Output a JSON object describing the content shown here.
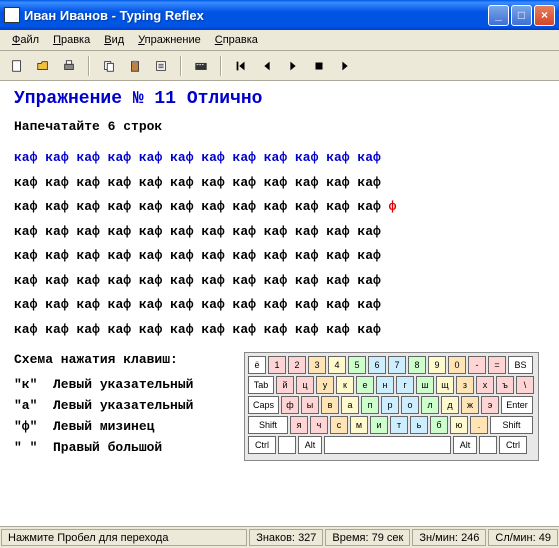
{
  "window": {
    "title": "Иван Иванов - Typing Reflex"
  },
  "menu": {
    "items": [
      "Файл",
      "Правка",
      "Вид",
      "Упражнение",
      "Справка"
    ]
  },
  "exercise": {
    "title": "Упражнение № 11  Отлично",
    "instruction": "Напечатайте 6 строк",
    "word": "каф",
    "error_char": "ф"
  },
  "scheme": {
    "title": "Схема нажатия клавиш:",
    "rows": [
      {
        "key": "\"к\"",
        "desc": "Левый указательный"
      },
      {
        "key": "\"а\"",
        "desc": "Левый указательный"
      },
      {
        "key": "\"ф\"",
        "desc": "Левый мизинец"
      },
      {
        "key": "\" \"",
        "desc": "Правый большой"
      }
    ]
  },
  "keyboard": {
    "row1": [
      "ё",
      "1",
      "2",
      "3",
      "4",
      "5",
      "6",
      "7",
      "8",
      "9",
      "0",
      "-",
      "=",
      "BS"
    ],
    "row2": [
      "Tab",
      "й",
      "ц",
      "у",
      "к",
      "е",
      "н",
      "г",
      "ш",
      "щ",
      "з",
      "х",
      "ъ",
      "\\"
    ],
    "row3": [
      "Caps",
      "ф",
      "ы",
      "в",
      "а",
      "п",
      "р",
      "о",
      "л",
      "д",
      "ж",
      "э",
      "Enter"
    ],
    "row4": [
      "Shift",
      "я",
      "ч",
      "с",
      "м",
      "и",
      "т",
      "ь",
      "б",
      "ю",
      ".",
      "Shift"
    ],
    "row5": [
      "Ctrl",
      "",
      "Alt",
      "",
      "Alt",
      "",
      "Ctrl"
    ]
  },
  "status": {
    "hint": "Нажмите Пробел для перехода",
    "chars_label": "Знаков:",
    "chars": "327",
    "time_label": "Время:",
    "time": "79 сек",
    "cpm_label": "Зн/мин:",
    "cpm": "246",
    "wpm_label": "Сл/мин:",
    "wpm": "49"
  }
}
